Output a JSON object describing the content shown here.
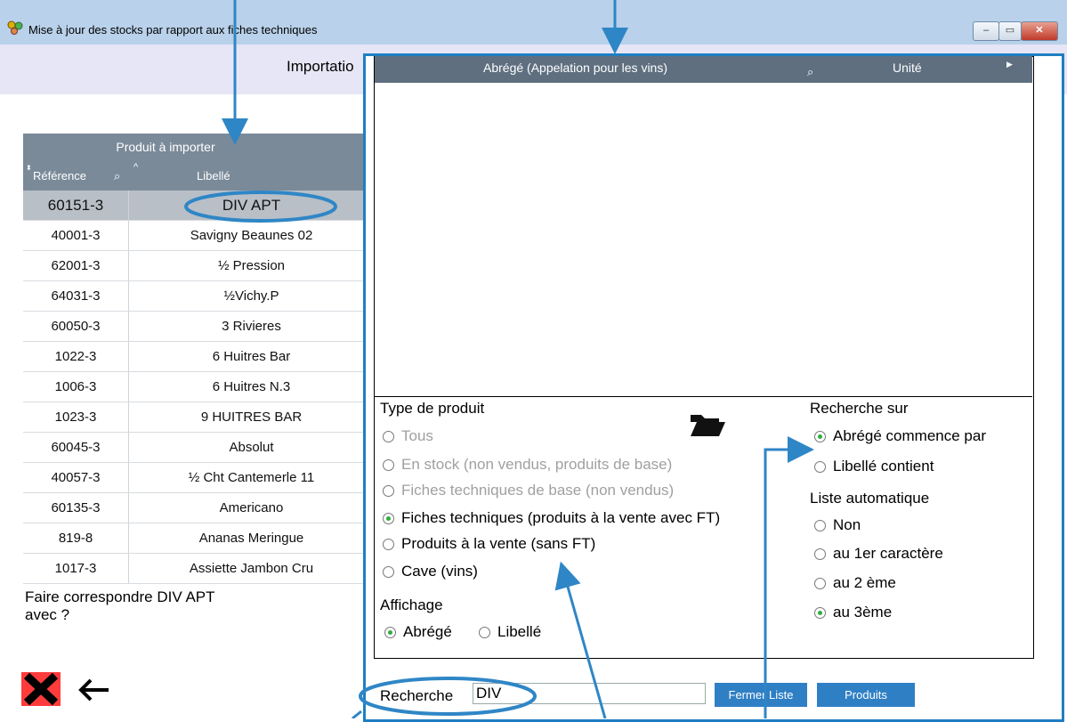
{
  "window": {
    "title": "Mise à jour des stocks par rapport aux fiches techniques",
    "minimize": "–",
    "maximize": "▭",
    "close": "✕"
  },
  "header": {
    "text": "Importatio"
  },
  "products_grid": {
    "group_header": "Produit à importer",
    "col_reference": "Référence",
    "col_libelle": "Libellé",
    "rows": [
      {
        "ref": "60151-3",
        "label": "DIV APT"
      },
      {
        "ref": "40001-3",
        "label": "Savigny Beaunes 02"
      },
      {
        "ref": "62001-3",
        "label": "½ Pression"
      },
      {
        "ref": "64031-3",
        "label": "½Vichy.P"
      },
      {
        "ref": "60050-3",
        "label": "3 Rivieres"
      },
      {
        "ref": "1022-3",
        "label": "6 Huitres Bar"
      },
      {
        "ref": "1006-3",
        "label": "6 Huitres N.3"
      },
      {
        "ref": "1023-3",
        "label": "9 HUITRES BAR"
      },
      {
        "ref": "60045-3",
        "label": "Absolut"
      },
      {
        "ref": "40057-3",
        "label": "½ Cht Cantemerle 11"
      },
      {
        "ref": "60135-3",
        "label": "Americano"
      },
      {
        "ref": "819-8",
        "label": "Ananas Meringue"
      },
      {
        "ref": "1017-3",
        "label": "Assiette Jambon Cru"
      }
    ]
  },
  "match_question": {
    "line1": "Faire correspondre DIV APT",
    "line2": "avec ?"
  },
  "popup": {
    "col_abrege": "Abrégé (Appelation pour les vins)",
    "col_unite": "Unité",
    "type_title": "Type de produit",
    "types": [
      {
        "label": "Tous"
      },
      {
        "label": "En stock (non vendus, produits de base)"
      },
      {
        "label": "Fiches techniques de base (non vendus)"
      },
      {
        "label": "Fiches techniques (produits à la vente avec FT)"
      },
      {
        "label": "Produits à la vente (sans FT)"
      },
      {
        "label": "Cave (vins)"
      }
    ],
    "affichage_title": "Affichage",
    "affichage_abrege": "Abrégé",
    "affichage_libelle": "Libellé",
    "recherche_sur_title": "Recherche sur",
    "recherche_sur": [
      {
        "label": "Abrégé commence par"
      },
      {
        "label": "Libellé contient"
      }
    ],
    "liste_auto_title": "Liste automatique",
    "liste_auto": [
      {
        "label": "Non"
      },
      {
        "label": "au 1er caractère"
      },
      {
        "label": "au 2 ème"
      },
      {
        "label": "au 3ème"
      }
    ],
    "search_label": "Recherche",
    "search_value": "DIV",
    "btn_fermer": "Fermer Liste",
    "btn_produits": "Produits"
  },
  "colors": {
    "annotation": "#2f86c6",
    "panel_border": "#1f7ec2",
    "grid_header": "#7a8a99"
  }
}
